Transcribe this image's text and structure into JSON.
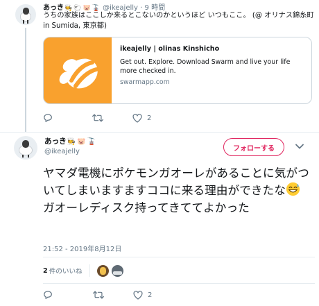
{
  "parent_tweet": {
    "name": "あっき",
    "name_emojis": [
      "🧑‍🍳",
      "🐑",
      "🐷",
      "🚡"
    ],
    "handle": "@ikeajelly",
    "separator": "·",
    "time": "9 時間",
    "text": "うちの家族はここしか来るとこないのかというほど いつもここ。 (@ オリナス錦糸町 in Sumida, 東京都)",
    "card": {
      "title": "ikeajelly | olinas Kinshicho",
      "description": "Get out. Explore. Download Swarm and live your life more checked in.",
      "domain": "swarmapp.com",
      "image_icon": "swarm-bee-logo",
      "image_color": "#f9a12e"
    },
    "actions": {
      "reply_count": "",
      "retweet_count": "",
      "like_count": "2"
    }
  },
  "main_tweet": {
    "name": "あっき",
    "name_emojis": [
      "🧑‍🍳",
      "🐷",
      "🚡"
    ],
    "handle": "@ikeajelly",
    "follow_label": "フォローする",
    "text_before_emoji": "ヤマダ電機にポケモンガオーレがあることに気がついてしまいますますココに来る理由ができたな",
    "text_after_emoji": " ガオーレディスク持ってきててよかった",
    "inline_emoji": "grinning-sweat-emoji",
    "timestamp": "21:52 - 2019年8月12日",
    "likes_count": "2",
    "likes_label": "件のいいね",
    "actions": {
      "reply_count": "",
      "retweet_count": "",
      "like_count": "2"
    }
  },
  "colors": {
    "accent_like": "#e0245e",
    "secondary_text": "#657786",
    "border": "#e6ecf0"
  }
}
